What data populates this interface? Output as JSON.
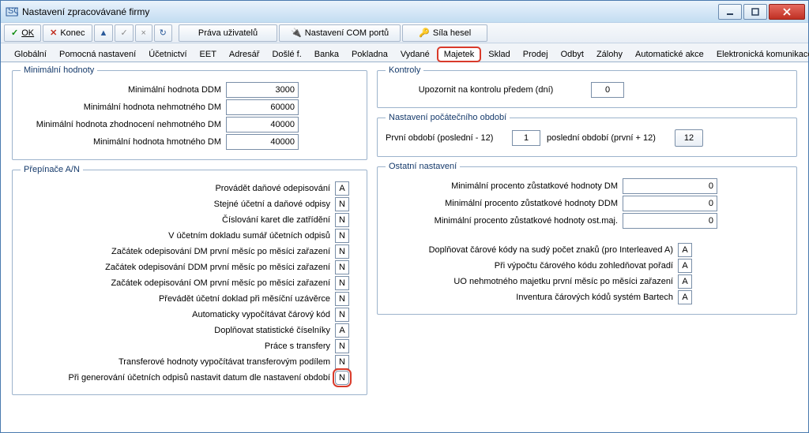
{
  "titlebar": {
    "title": "Nastavení zpracovávané firmy",
    "icon_label": "SQL"
  },
  "toolbar": {
    "ok": "OK",
    "konec": "Konec",
    "prava": "Práva uživatelů",
    "com": "Nastavení COM portů",
    "sila": "Síla hesel"
  },
  "tabs": [
    "Globální",
    "Pomocná nastavení",
    "Účetnictví",
    "EET",
    "Adresář",
    "Došlé f.",
    "Banka",
    "Pokladna",
    "Vydané",
    "Majetek",
    "Sklad",
    "Prodej",
    "Odbyt",
    "Zálohy",
    "Automatické akce",
    "Elektronická komunikace"
  ],
  "active_tab_index": 9,
  "groups": {
    "minvals": {
      "legend": "Minimální hodnoty",
      "rows": [
        {
          "label": "Minimální hodnota DDM",
          "value": "3000"
        },
        {
          "label": "Minimální hodnota nehmotného DM",
          "value": "60000"
        },
        {
          "label": "Minimální hodnota zhodnocení nehmotného DM",
          "value": "40000"
        },
        {
          "label": "Minimální hodnota hmotného DM",
          "value": "40000"
        }
      ]
    },
    "switches": {
      "legend": "Přepínače A/N",
      "rows": [
        {
          "label": "Provádět daňové odepisování",
          "value": "A"
        },
        {
          "label": "Stejné účetní a daňové odpisy",
          "value": "N"
        },
        {
          "label": "Číslování karet dle zatřídění",
          "value": "N"
        },
        {
          "label": "V účetním dokladu sumář účetních odpisů",
          "value": "N"
        },
        {
          "label": "Začátek odepisování DM první měsíc po měsíci zařazení",
          "value": "N"
        },
        {
          "label": "Začátek odepisování DDM první měsíc po měsíci zařazení",
          "value": "N"
        },
        {
          "label": "Začátek odepisování OM první měsíc po měsíci zařazení",
          "value": "N"
        },
        {
          "label": "Převádět účetní doklad při měsíční uzávěrce",
          "value": "N"
        },
        {
          "label": "Automaticky vypočítávat čárový kód",
          "value": "N"
        },
        {
          "label": "Doplňovat statistické číselníky",
          "value": "A"
        },
        {
          "label": "Práce s transfery",
          "value": "N"
        },
        {
          "label": "Transferové hodnoty vypočítávat transferovým podílem",
          "value": "N"
        },
        {
          "label": "Při generování účetních odpisů nastavit datum dle nastavení období",
          "value": "N",
          "highlight": true
        }
      ]
    },
    "kontroly": {
      "legend": "Kontroly",
      "label": "Upozornit na kontrolu předem (dní)",
      "value": "0"
    },
    "nastpoc": {
      "legend": "Nastavení počátečního období",
      "label1": "První období (poslední - 12)",
      "value1": "1",
      "label2": "poslední období (první + 12)",
      "btn": "12"
    },
    "ostatni": {
      "legend": "Ostatní nastavení",
      "pct": [
        {
          "label": "Minimální procento zůstatkové hodnoty DM",
          "value": "0"
        },
        {
          "label": "Minimální procento zůstatkové hodnoty DDM",
          "value": "0"
        },
        {
          "label": "Minimální procento zůstatkové hodnoty ost.maj.",
          "value": "0"
        }
      ],
      "flags": [
        {
          "label": "Doplňovat čárové kódy na sudý počet znaků (pro Interleaved A)",
          "value": "A"
        },
        {
          "label": "Při výpočtu čárového kódu zohledňovat pořadí",
          "value": "A"
        },
        {
          "label": "UO nehmotného majetku první měsíc po měsíci zařazení",
          "value": "A"
        },
        {
          "label": "Inventura čárových kódů systém Bartech",
          "value": "A"
        }
      ]
    }
  }
}
